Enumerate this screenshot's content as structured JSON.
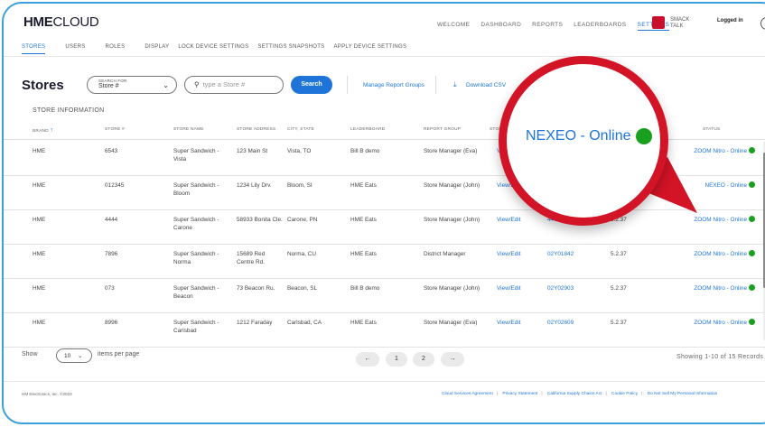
{
  "header": {
    "logo_bold": "HME",
    "logo_light": "CLOUD",
    "nav": [
      "WELCOME",
      "DASHBOARD",
      "REPORTS",
      "LEADERBOARDS",
      "SETTINGS"
    ],
    "active_nav": "SETTINGS",
    "smack_talk": "SMACK TALK",
    "logged_in": "Logged in"
  },
  "subnav": [
    "STORES",
    "USERS",
    "ROLES",
    "DISPLAY",
    "LOCK DEVICE SETTINGS",
    "SETTINGS SNAPSHOTS",
    "APPLY DEVICE SETTINGS"
  ],
  "page": {
    "title": "Stores",
    "search_for_label": "SEARCH FOR",
    "search_for_value": "Store #",
    "search_placeholder": "type a Store #",
    "search_button": "Search",
    "manage_groups": "Manage Report Groups",
    "download_csv": "Download CSV",
    "section": "STORE INFORMATION"
  },
  "table": {
    "headers": [
      "BRAND",
      "STORE #",
      "STORE NAME",
      "STORE ADDRESS",
      "CITY, STATE",
      "LEADERBOARD",
      "REPORT GROUP",
      "STORE #",
      "",
      "",
      "STATUS"
    ],
    "rows": [
      {
        "brand": "HME",
        "store": "6543",
        "name": "Super Sandwich - Vista",
        "address": "123 Main St",
        "city": "Vista, TO",
        "leaderboard": "Bill B demo",
        "group": "Store Manager (Eva)",
        "action": "View/Edit",
        "serial": "",
        "version": "",
        "status": "ZOOM Nitro - Online"
      },
      {
        "brand": "HME",
        "store": "012345",
        "name": "Super Sandwich - Bloom",
        "address": "1234 Lily Drv.",
        "city": "Bloom, SI",
        "leaderboard": "HME Eats",
        "group": "Store Manager (John)",
        "action": "View/Edit",
        "serial": "",
        "version": "",
        "status": "NEXEO - Online"
      },
      {
        "brand": "HME",
        "store": "4444",
        "name": "Super Sandwich - Carone",
        "address": "58933 Bonita Cle.",
        "city": "Carone, PN",
        "leaderboard": "HME Eats",
        "group": "Store Manager (John)",
        "action": "View/Edit",
        "serial": "44W00247",
        "version": "5.2.37",
        "status": "ZOOM Nitro - Online"
      },
      {
        "brand": "HME",
        "store": "7896",
        "name": "Super Sandwich - Norma",
        "address": "15689 Red Centre Rd.",
        "city": "Norma, CU",
        "leaderboard": "HME Eats",
        "group": "District Manager",
        "action": "View/Edit",
        "serial": "02Y01842",
        "version": "5.2.37",
        "status": "ZOOM Nitro - Online"
      },
      {
        "brand": "HME",
        "store": "073",
        "name": "Super Sandwich - Beacon",
        "address": "73 Beacon Ru.",
        "city": "Beacon, SL",
        "leaderboard": "Bill B demo",
        "group": "Store Manager (John)",
        "action": "View/Edit",
        "serial": "02Y02903",
        "version": "5.2.37",
        "status": "ZOOM Nitro - Online"
      },
      {
        "brand": "HME",
        "store": "8996",
        "name": "Super Sandwich - Carlsbad",
        "address": "1212 Faraday",
        "city": "Carlsbad, CA",
        "leaderboard": "HME Eats",
        "group": "Store Manager (Eva)",
        "action": "View/Edit",
        "serial": "02Y02609",
        "version": "5.2.37",
        "status": "ZOOM Nitro - Online"
      }
    ]
  },
  "pagination": {
    "show": "Show",
    "per_page": "10",
    "items_per_page": "items per page",
    "prev": "←",
    "pages": [
      "1",
      "2"
    ],
    "next": "→",
    "showing": "Showing 1-10 of 15 Records"
  },
  "footer": {
    "copyright": "HM Electronics, Inc. ©2023",
    "links": [
      "Cloud Services Agreement",
      "Privacy Statement",
      "California Supply Chains Act",
      "Cookie Policy",
      "Do Not Sell My Personal Information"
    ]
  },
  "callout": {
    "text": "NEXEO - Online"
  },
  "colors": {
    "accent": "#1e74d8",
    "online": "#18a01e",
    "callout_ring": "#d21426"
  }
}
